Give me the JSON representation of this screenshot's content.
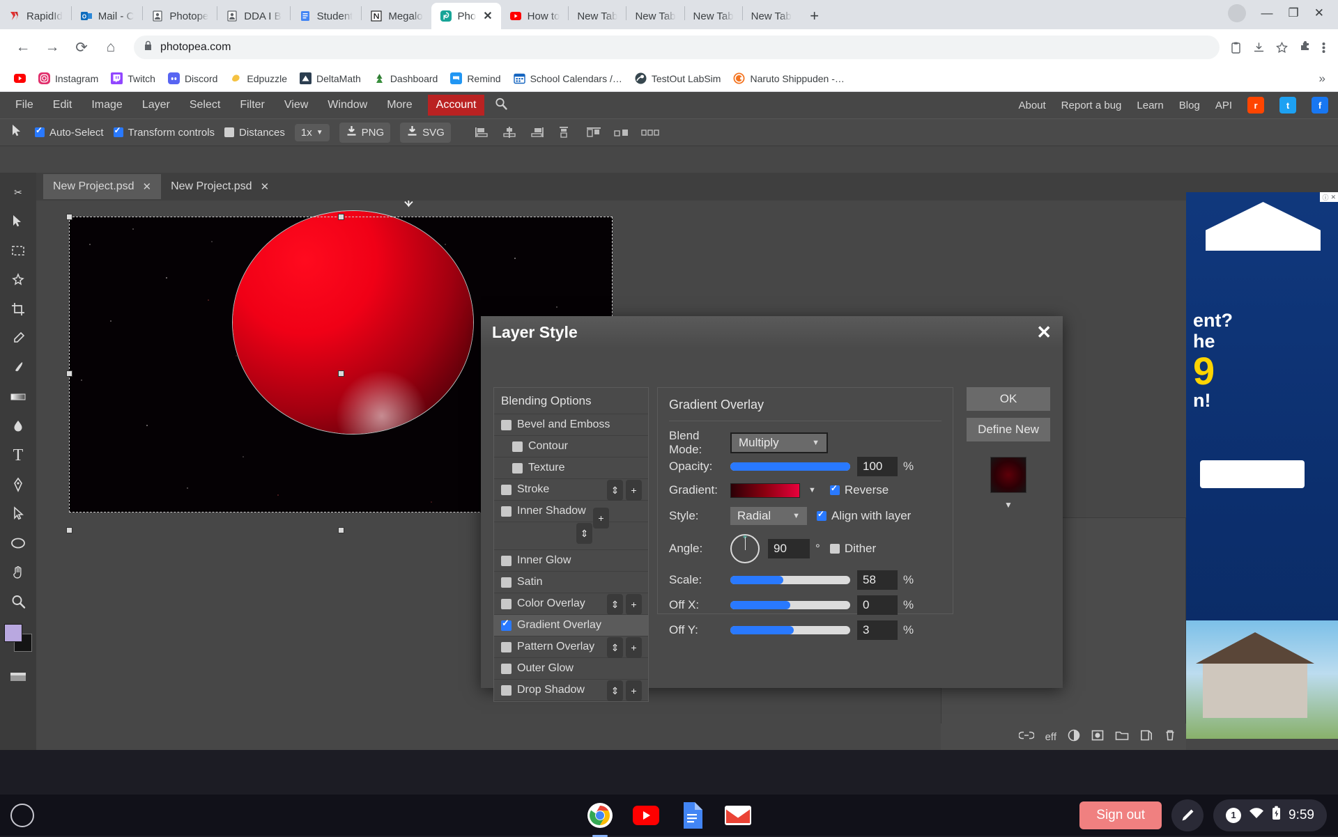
{
  "browser": {
    "tabs": [
      {
        "title": "RapidId",
        "icon": "rapididentity-icon",
        "color": "#e03131",
        "active": false
      },
      {
        "title": "Mail - C",
        "icon": "outlook-icon",
        "color": "#0f6cbd",
        "active": false
      },
      {
        "title": "Photope",
        "icon": "person-icon",
        "color": "#5f6368",
        "active": false
      },
      {
        "title": "DDA I B",
        "icon": "person-icon",
        "color": "#5f6368",
        "active": false
      },
      {
        "title": "Student",
        "icon": "google-docs-icon",
        "color": "#4285f4",
        "active": false
      },
      {
        "title": "Megalo",
        "icon": "notion-icon",
        "color": "#ffffff",
        "active": false
      },
      {
        "title": "Pho",
        "icon": "photopea-icon",
        "color": "#18a497",
        "active": true
      },
      {
        "title": "How to",
        "icon": "youtube-icon",
        "color": "#ff0000",
        "active": false
      },
      {
        "title": "New Tab",
        "icon": "none",
        "color": "#dee1e6",
        "active": false
      },
      {
        "title": "New Tab",
        "icon": "none",
        "color": "#dee1e6",
        "active": false
      },
      {
        "title": "New Tab",
        "icon": "none",
        "color": "#dee1e6",
        "active": false
      },
      {
        "title": "New Tab",
        "icon": "none",
        "color": "#dee1e6",
        "active": false
      }
    ],
    "new_tab_label": "+",
    "window_controls": {
      "minimize": "—",
      "maximize": "❐",
      "close": "✕"
    },
    "nav": {
      "back": "←",
      "forward": "→",
      "reload": "⟳",
      "home": "⌂"
    },
    "url": "photopea.com",
    "lock_icon": "lock-icon",
    "omni_right": [
      "clipboard-icon",
      "download-icon",
      "star-icon",
      "extensions-icon",
      "menu-icon"
    ],
    "bookmarks": [
      {
        "label": "",
        "icon": "youtube-icon",
        "color": "#ff0000"
      },
      {
        "label": "Instagram",
        "icon": "instagram-icon",
        "color": "#e1306c"
      },
      {
        "label": "Twitch",
        "icon": "twitch-icon",
        "color": "#9146ff"
      },
      {
        "label": "Discord",
        "icon": "discord-icon",
        "color": "#5865f2"
      },
      {
        "label": "Edpuzzle",
        "icon": "edpuzzle-icon",
        "color": "#f5c242"
      },
      {
        "label": "DeltaMath",
        "icon": "deltamath-icon",
        "color": "#2c3e50"
      },
      {
        "label": "Dashboard",
        "icon": "dashboard-icon",
        "color": "#2e7d32"
      },
      {
        "label": "Remind",
        "icon": "remind-icon",
        "color": "#2196f3"
      },
      {
        "label": "School Calendars /…",
        "icon": "calendar-icon",
        "color": "#1565c0"
      },
      {
        "label": "TestOut LabSim",
        "icon": "testout-icon",
        "color": "#37474f"
      },
      {
        "label": "Naruto Shippuden -…",
        "icon": "crunchyroll-icon",
        "color": "#f47521"
      }
    ],
    "bookmarks_overflow": "»"
  },
  "photopea": {
    "menus": [
      "File",
      "Edit",
      "Image",
      "Layer",
      "Select",
      "Filter",
      "View",
      "Window",
      "More"
    ],
    "account_label": "Account",
    "search_icon": "search-icon",
    "right_links": [
      "About",
      "Report a bug",
      "Learn",
      "Blog",
      "API"
    ],
    "social": [
      {
        "name": "reddit-icon",
        "label": "r",
        "color": "#ff4500"
      },
      {
        "name": "twitter-icon",
        "label": "t",
        "color": "#1da1f2"
      },
      {
        "name": "facebook-icon",
        "label": "f",
        "color": "#1877f2"
      }
    ],
    "options_bar": {
      "tool_icon": "move-tool-icon",
      "auto_select": {
        "label": "Auto-Select",
        "checked": true
      },
      "transform_controls": {
        "label": "Transform controls",
        "checked": true
      },
      "distances": {
        "label": "Distances",
        "checked": false
      },
      "zoom_select": "1x",
      "export_png": "PNG",
      "export_svg": "SVG",
      "align_icons": [
        "align-left-icon",
        "align-center-h-icon",
        "align-right-icon",
        "align-top-icon",
        "distribute-icon",
        "distribute-2-icon",
        "distribute-3-icon"
      ]
    },
    "tools": [
      "move-tool-icon",
      "marquee-tool-icon",
      "lasso-tool-icon",
      "magic-wand-icon",
      "crop-tool-icon",
      "eyedropper-icon",
      "brush-tool-icon",
      "gradient-tool-icon",
      "blur-tool-icon",
      "type-tool-icon",
      "pen-tool-icon",
      "path-select-icon",
      "shape-ellipse-icon",
      "hand-tool-icon",
      "zoom-tool-icon"
    ],
    "foreground_color": "#b9a8e0",
    "background_color": "#141414",
    "doc_tabs": [
      {
        "label": "New Project.psd",
        "active": true
      },
      {
        "label": "New Project.psd",
        "active": false
      }
    ],
    "panel_footer_icons": [
      "link-icon",
      "eff-icon",
      "adjustment-icon",
      "mask-icon",
      "folder-icon",
      "new-layer-icon",
      "trash-icon"
    ],
    "panel_footer_text": "eff"
  },
  "layer_style": {
    "title": "Layer Style",
    "close_icon": "close-icon",
    "effects": [
      {
        "label": "Blending Options",
        "type": "header",
        "checked": null,
        "selected": false,
        "sub": false
      },
      {
        "label": "Bevel and Emboss",
        "checked": false,
        "selected": false,
        "sub": false
      },
      {
        "label": "Contour",
        "checked": false,
        "selected": false,
        "sub": true
      },
      {
        "label": "Texture",
        "checked": false,
        "selected": false,
        "sub": true
      },
      {
        "label": "Stroke",
        "checked": false,
        "selected": false,
        "sub": false
      },
      {
        "label": "Inner Shadow",
        "checked": false,
        "selected": false,
        "sub": false
      },
      {
        "label": "Inner Glow",
        "checked": false,
        "selected": false,
        "sub": false
      },
      {
        "label": "Satin",
        "checked": false,
        "selected": false,
        "sub": false
      },
      {
        "label": "Color Overlay",
        "checked": false,
        "selected": false,
        "sub": false
      },
      {
        "label": "Gradient Overlay",
        "checked": true,
        "selected": true,
        "sub": false
      },
      {
        "label": "Pattern Overlay",
        "checked": false,
        "selected": false,
        "sub": false
      },
      {
        "label": "Outer Glow",
        "checked": false,
        "selected": false,
        "sub": false
      },
      {
        "label": "Drop Shadow",
        "checked": false,
        "selected": false,
        "sub": false
      }
    ],
    "settings": {
      "panel_title": "Gradient Overlay",
      "blend_mode": {
        "label": "Blend Mode:",
        "value": "Multiply"
      },
      "opacity": {
        "label": "Opacity:",
        "value": "100",
        "unit": "%",
        "percent": 100
      },
      "gradient": {
        "label": "Gradient:",
        "caret": "▼",
        "colors": [
          "#2b0006",
          "#8c0010",
          "#e8003c"
        ]
      },
      "reverse": {
        "label": "Reverse",
        "checked": true
      },
      "style": {
        "label": "Style:",
        "value": "Radial"
      },
      "align_with_layer": {
        "label": "Align with layer",
        "checked": true
      },
      "angle": {
        "label": "Angle:",
        "value": "90",
        "unit": "°"
      },
      "dither": {
        "label": "Dither",
        "checked": false
      },
      "scale": {
        "label": "Scale:",
        "value": "58",
        "unit": "%",
        "percent": 44
      },
      "off_x": {
        "label": "Off X:",
        "value": "0",
        "unit": "%",
        "percent": 50
      },
      "off_y": {
        "label": "Off Y:",
        "value": "3",
        "unit": "%",
        "percent": 53
      }
    },
    "ok_label": "OK",
    "define_new_label": "Define New",
    "preview_caret": "▼"
  },
  "ad": {
    "headline_line1": "ent?",
    "headline_line2": "he",
    "big_number": "9",
    "headline_line3": "n!",
    "close_icon": "ad-close-icon",
    "info_icon": "ad-info-icon"
  },
  "shelf": {
    "launcher_icon": "launcher-icon",
    "apps": [
      {
        "name": "chrome-icon",
        "running": true
      },
      {
        "name": "youtube-icon",
        "running": false
      },
      {
        "name": "google-docs-icon",
        "running": false
      },
      {
        "name": "gmail-icon",
        "running": false
      }
    ],
    "sign_out_label": "Sign out",
    "pen_icon": "stylus-icon",
    "notification_count": "1",
    "wifi_icon": "wifi-icon",
    "battery_icon": "battery-charging-icon",
    "time": "9:59"
  }
}
